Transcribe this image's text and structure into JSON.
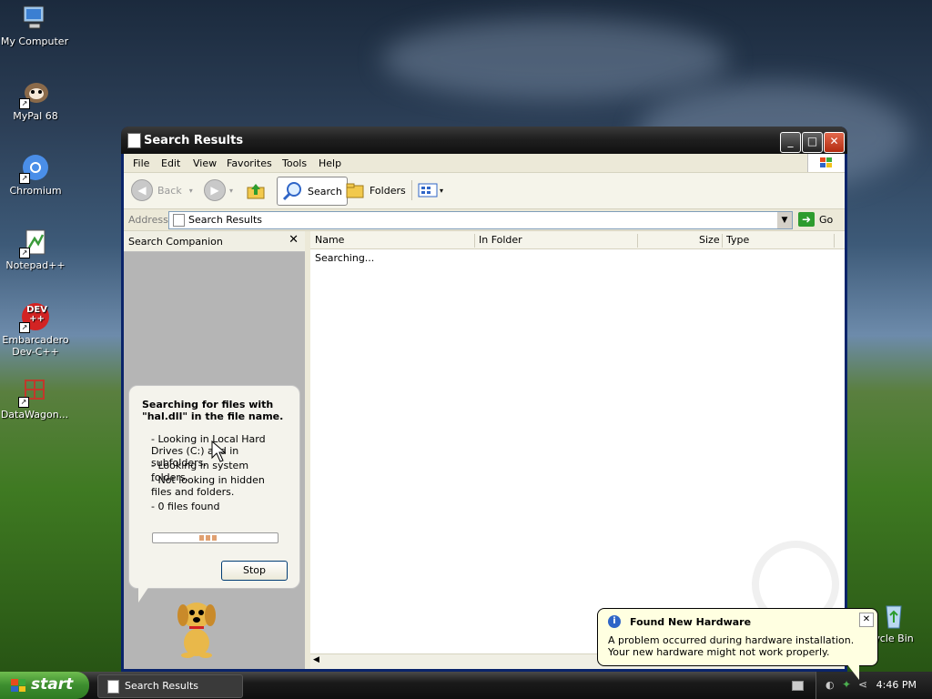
{
  "desktop": {
    "icons": [
      {
        "label": "My Computer"
      },
      {
        "label": "MyPal 68"
      },
      {
        "label": "Chromium"
      },
      {
        "label": "Notepad++"
      },
      {
        "label": "Embarcadero Dev-C++",
        "badge": "DEV ++"
      },
      {
        "label": "DataWagon..."
      },
      {
        "label": "ycle Bin"
      }
    ]
  },
  "window": {
    "title": "Search Results",
    "menu": [
      "File",
      "Edit",
      "View",
      "Favorites",
      "Tools",
      "Help"
    ],
    "toolbar": {
      "back": "Back",
      "search": "Search",
      "folders": "Folders"
    },
    "address": {
      "label": "Address",
      "value": "Search Results",
      "go": "Go"
    },
    "companion": {
      "title": "Search Companion",
      "heading": "Searching for files with \"hal.dll\" in the file name.",
      "lines": [
        "- Looking in Local Hard Drives (C:) and in subfolders.",
        "- Looking in system folders.",
        "- Not looking in hidden files and folders.",
        "- 0 files found"
      ],
      "stop": "Stop"
    },
    "results": {
      "columns": [
        "Name",
        "In Folder",
        "Size",
        "Type"
      ],
      "status": "Searching..."
    }
  },
  "taskbar": {
    "start": "start",
    "task": "Search Results",
    "clock": "4:46 PM"
  },
  "notification": {
    "title": "Found New Hardware",
    "body": "A problem occurred during hardware installation. Your new hardware might not work properly."
  }
}
